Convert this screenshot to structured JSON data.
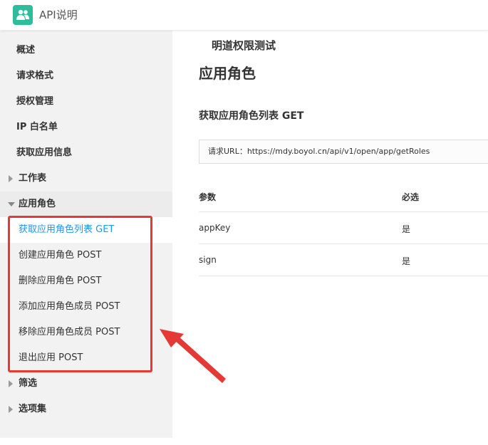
{
  "header": {
    "title": "明道权限测试",
    "subtitle": "API说明"
  },
  "sidebar": {
    "items": [
      {
        "label": "概述"
      },
      {
        "label": "请求格式"
      },
      {
        "label": "授权管理"
      },
      {
        "label": "IP 白名单"
      },
      {
        "label": "获取应用信息"
      },
      {
        "label": "工作表"
      },
      {
        "label": "应用角色"
      },
      {
        "label": "筛选"
      },
      {
        "label": "选项集"
      }
    ],
    "sub_items": [
      {
        "label": "获取应用角色列表 GET"
      },
      {
        "label": "创建应用角色 POST"
      },
      {
        "label": "删除应用角色 POST"
      },
      {
        "label": "添加应用角色成员 POST"
      },
      {
        "label": "移除应用角色成员 POST"
      },
      {
        "label": "退出应用 POST"
      }
    ]
  },
  "main": {
    "page_title": "应用角色",
    "section_title": "获取应用角色列表 GET",
    "url_label": "请求URL：https://mdy.boyol.cn/api/v1/open/app/getRoles",
    "table": {
      "headers": [
        "参数",
        "必选"
      ],
      "rows": [
        [
          "appKey",
          "是"
        ],
        [
          "sign",
          "是"
        ]
      ]
    }
  },
  "colors": {
    "accent": "#2196f3",
    "logo": "#2ebc9b",
    "highlight": "#e53935"
  },
  "icons": [
    "users-logo-icon",
    "caret-right-icon",
    "caret-down-icon"
  ]
}
